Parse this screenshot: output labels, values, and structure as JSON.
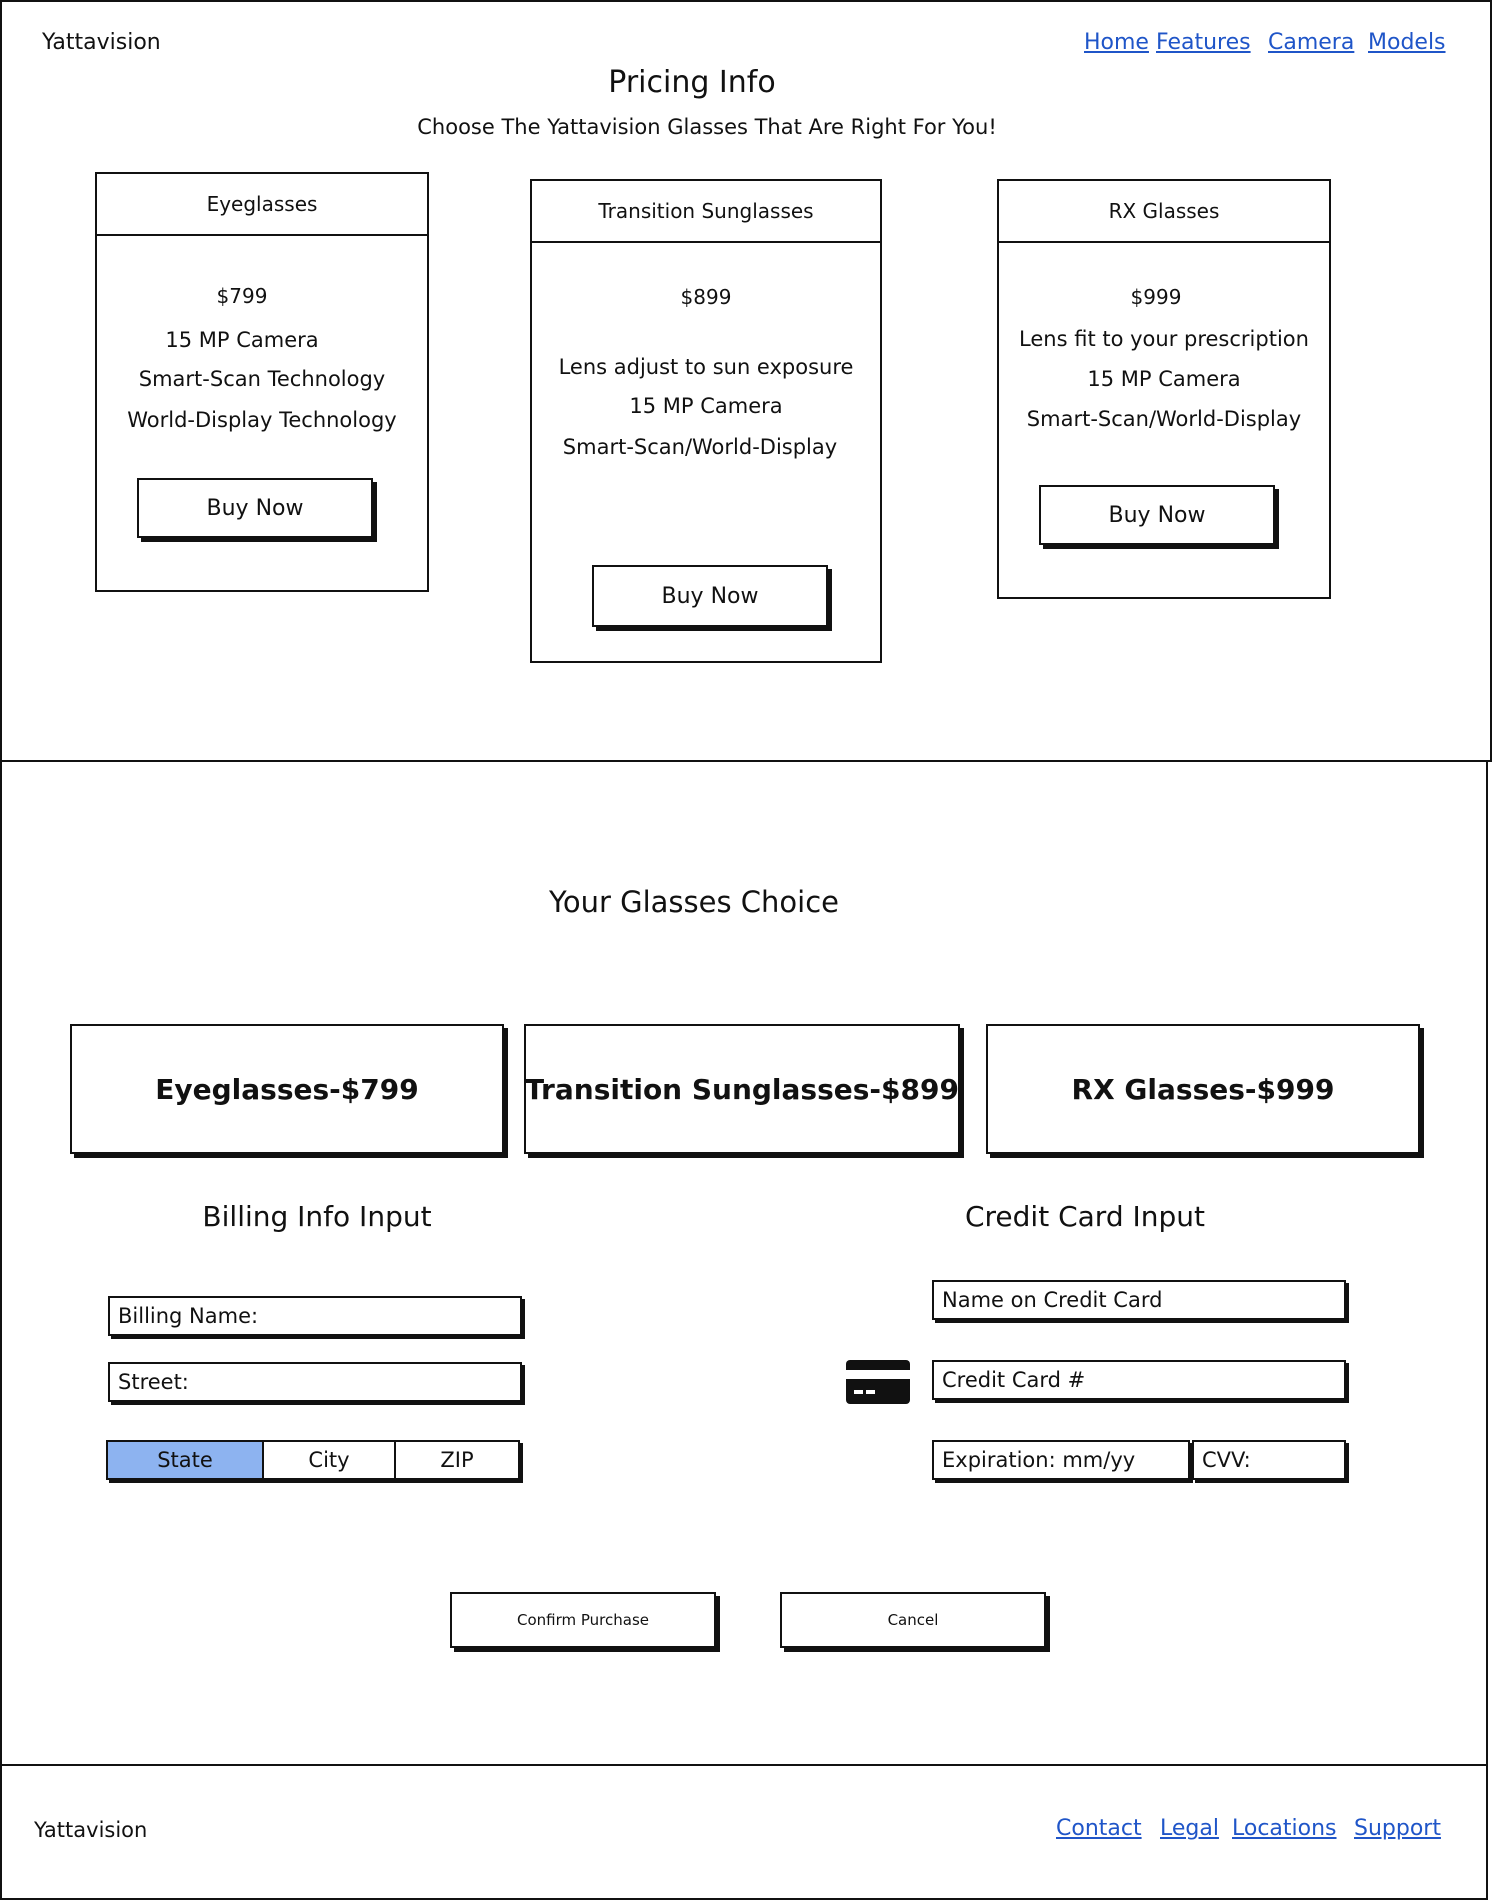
{
  "header": {
    "logo": "Yattavision",
    "nav": [
      "Home",
      "Features",
      "Camera",
      "Models"
    ]
  },
  "pricing": {
    "title": "Pricing Info",
    "subtitle": "Choose The Yattavision Glasses That Are Right For You!",
    "cards": [
      {
        "name": "Eyeglasses",
        "price": "$799",
        "features": [
          "15 MP Camera",
          "Smart-Scan Technology",
          "World-Display Technology"
        ],
        "button": "Buy Now"
      },
      {
        "name": "Transition Sunglasses",
        "price": "$899",
        "features": [
          "Lens adjust to sun exposure",
          "15 MP Camera",
          "Smart-Scan/World-Display"
        ],
        "button": "Buy Now"
      },
      {
        "name": "RX Glasses",
        "price": "$999",
        "features": [
          "Lens fit to your prescription",
          "15 MP Camera",
          "Smart-Scan/World-Display"
        ],
        "button": "Buy Now"
      }
    ]
  },
  "checkout": {
    "title": "Your Glasses Choice",
    "choices": [
      "Eyeglasses-$799",
      "Transition Sunglasses-$899",
      "RX Glasses-$999"
    ],
    "billing": {
      "title": "Billing Info Input",
      "name": "Billing Name:",
      "street": "Street:",
      "segments": [
        "State",
        "City",
        "ZIP"
      ],
      "selected_segment": "State"
    },
    "credit": {
      "title": "Credit Card Input",
      "name": "Name on Credit Card",
      "number": "Credit Card #",
      "expiration": "Expiration: mm/yy",
      "cvv": "CVV:",
      "icon": "credit-card-icon"
    },
    "confirm": "Confirm Purchase",
    "cancel": "Cancel"
  },
  "footer": {
    "logo": "Yattavision",
    "links": [
      "Contact",
      "Legal",
      "Locations",
      "Support"
    ]
  },
  "colors": {
    "link": "#1f55c8",
    "selected_segment": "#8db3f0",
    "border": "#111111"
  }
}
